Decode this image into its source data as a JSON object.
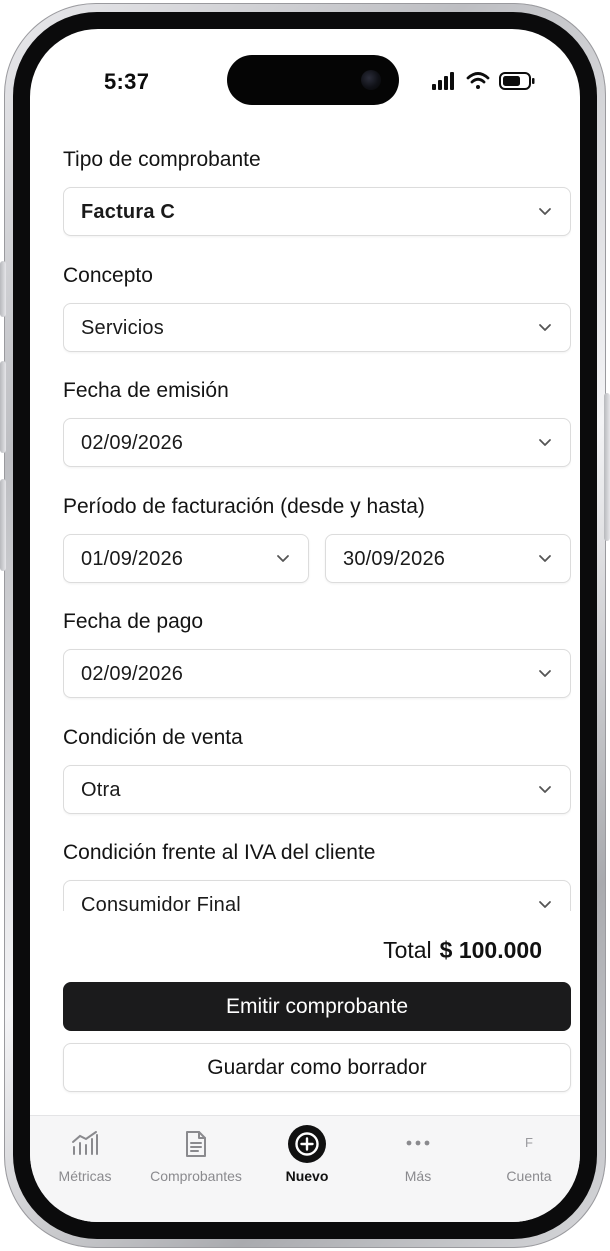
{
  "status_bar": {
    "time": "5:37"
  },
  "form": {
    "tipo": {
      "label": "Tipo de comprobante",
      "value": "Factura C"
    },
    "concepto": {
      "label": "Concepto",
      "value": "Servicios"
    },
    "fecha_emision": {
      "label": "Fecha de emisión",
      "value": "02/09/2026"
    },
    "periodo": {
      "label": "Período de facturación (desde y hasta)",
      "desde": "01/09/2026",
      "hasta": "30/09/2026"
    },
    "fecha_pago": {
      "label": "Fecha de pago",
      "value": "02/09/2026"
    },
    "condicion_venta": {
      "label": "Condición de venta",
      "value": "Otra"
    },
    "condicion_iva": {
      "label": "Condición frente al IVA del cliente",
      "value": "Consumidor Final"
    }
  },
  "summary": {
    "total_label": "Total",
    "total_value": "$ 100.000"
  },
  "actions": {
    "emit_label": "Emitir comprobante",
    "draft_label": "Guardar como borrador"
  },
  "tabbar": {
    "items": [
      {
        "label": "Métricas",
        "icon": "chart-icon"
      },
      {
        "label": "Comprobantes",
        "icon": "document-icon"
      },
      {
        "label": "Nuevo",
        "icon": "plus-circle-icon",
        "active": true
      },
      {
        "label": "Más",
        "icon": "more-icon"
      },
      {
        "label": "Cuenta",
        "icon": "avatar-initial",
        "initial": "F"
      }
    ]
  },
  "colors": {
    "primary": "#1b1b1c",
    "border": "#dcdcdc",
    "muted": "#8a8a8e"
  }
}
